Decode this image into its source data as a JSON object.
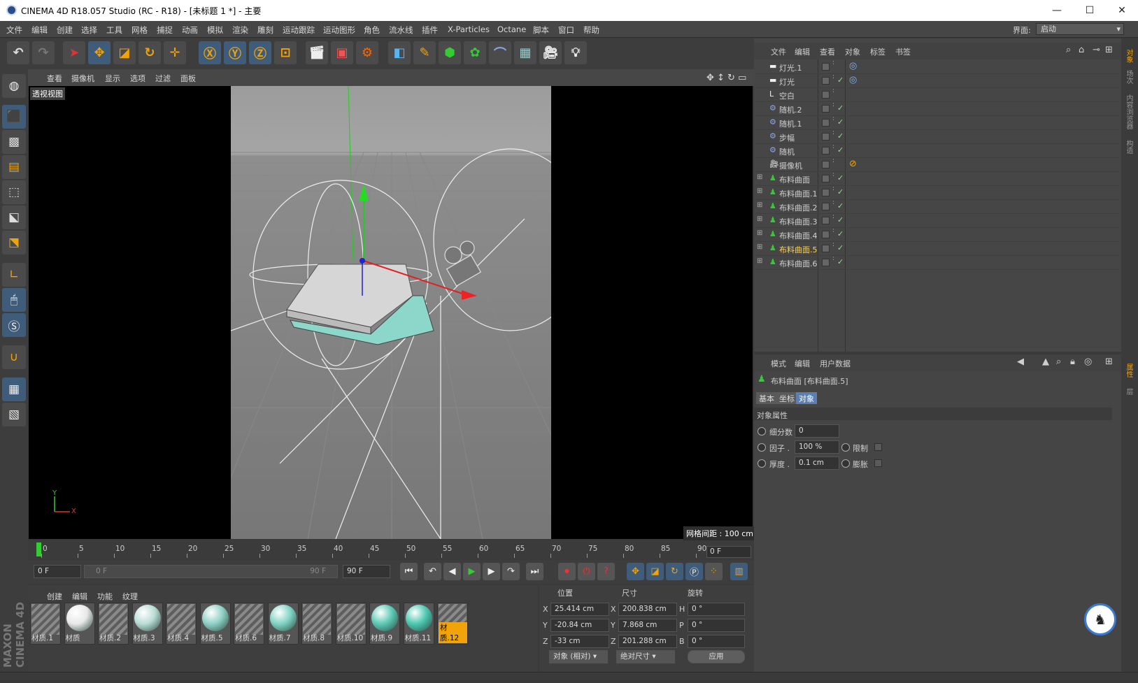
{
  "window": {
    "title": "CINEMA 4D R18.057 Studio (RC - R18) - [未标题 1 *] - 主要",
    "minimize": "—",
    "maximize": "☐",
    "close": "✕"
  },
  "menu": [
    "文件",
    "编辑",
    "创建",
    "选择",
    "工具",
    "网格",
    "捕捉",
    "动画",
    "模拟",
    "渲染",
    "雕刻",
    "运动跟踪",
    "运动图形",
    "角色",
    "流水线",
    "插件",
    "X-Particles",
    "Octane",
    "脚本",
    "窗口",
    "帮助"
  ],
  "layout": {
    "label": "界面:",
    "value": "启动"
  },
  "viewport": {
    "menu": [
      "查看",
      "摄像机",
      "显示",
      "选项",
      "过滤",
      "面板"
    ],
    "label": "透视视图",
    "grid_info": "网格间距 : 100 cm",
    "axis_y": "Y",
    "axis_x": "X"
  },
  "timeline": {
    "ticks": [
      "0",
      "5",
      "10",
      "15",
      "20",
      "25",
      "30",
      "35",
      "40",
      "45",
      "50",
      "55",
      "60",
      "65",
      "70",
      "75",
      "80",
      "85",
      "90"
    ],
    "current_frame": "0 F",
    "start_field": "0 F",
    "range_start": "0 F",
    "range_end": "90 F",
    "end_field": "90 F"
  },
  "materials": {
    "menu": [
      "创建",
      "编辑",
      "功能",
      "纹理"
    ],
    "items": [
      {
        "name": "材质.1",
        "kind": "striped"
      },
      {
        "name": "材质",
        "kind": "ball",
        "color": "#e8e8e8"
      },
      {
        "name": "材质.2",
        "kind": "striped"
      },
      {
        "name": "材质.3",
        "kind": "ball",
        "color": "#b8dcd4"
      },
      {
        "name": "材质.4",
        "kind": "striped"
      },
      {
        "name": "材质.5",
        "kind": "ball",
        "color": "#8fd0c4"
      },
      {
        "name": "材质.6",
        "kind": "striped"
      },
      {
        "name": "材质.7",
        "kind": "ball",
        "color": "#7fd4c4"
      },
      {
        "name": "材质.8",
        "kind": "striped"
      },
      {
        "name": "材质.10",
        "kind": "striped"
      },
      {
        "name": "材质.9",
        "kind": "ball",
        "color": "#5cc9b4"
      },
      {
        "name": "材质.11",
        "kind": "ball",
        "color": "#4cc8b0"
      },
      {
        "name": "材质.12",
        "kind": "striped",
        "selected": true
      }
    ]
  },
  "coords": {
    "headers": [
      "位置",
      "尺寸",
      "旋转"
    ],
    "rows": [
      {
        "a": "X",
        "pos": "25.414 cm",
        "b": "X",
        "size": "200.838 cm",
        "c": "H",
        "rot": "0 °"
      },
      {
        "a": "Y",
        "pos": "-20.84 cm",
        "b": "Y",
        "size": "7.868 cm",
        "c": "P",
        "rot": "0 °"
      },
      {
        "a": "Z",
        "pos": "-33 cm",
        "b": "Z",
        "size": "201.288 cm",
        "c": "B",
        "rot": "0 °"
      }
    ],
    "mode": "对象 (相对)",
    "size_mode": "绝对尺寸",
    "apply": "应用"
  },
  "objects": {
    "menu": [
      "文件",
      "编辑",
      "查看",
      "对象",
      "标签",
      "书签"
    ],
    "items": [
      {
        "name": "灯光.1",
        "icon": "light-icon",
        "check": false,
        "tag": "target-tag"
      },
      {
        "name": "灯光",
        "icon": "light-icon",
        "check": true,
        "tag": "target-tag"
      },
      {
        "name": "空白",
        "icon": "null-icon",
        "check": false,
        "tag": ""
      },
      {
        "name": "随机.2",
        "icon": "effector-icon",
        "check": true,
        "tag": ""
      },
      {
        "name": "随机.1",
        "icon": "effector-icon",
        "check": true,
        "tag": ""
      },
      {
        "name": "步幅",
        "icon": "effector-icon",
        "check": true,
        "tag": ""
      },
      {
        "name": "随机",
        "icon": "effector-icon",
        "check": true,
        "tag": ""
      },
      {
        "name": "摄像机",
        "icon": "camera-icon",
        "check": false,
        "tag": "protect-tag"
      },
      {
        "name": "布料曲面",
        "icon": "cloth-icon",
        "check": true,
        "tag": ""
      },
      {
        "name": "布料曲面.1",
        "icon": "cloth-icon",
        "check": true,
        "tag": ""
      },
      {
        "name": "布料曲面.2",
        "icon": "cloth-icon",
        "check": true,
        "tag": ""
      },
      {
        "name": "布料曲面.3",
        "icon": "cloth-icon",
        "check": true,
        "tag": ""
      },
      {
        "name": "布料曲面.4",
        "icon": "cloth-icon",
        "check": true,
        "tag": ""
      },
      {
        "name": "布料曲面.5",
        "icon": "cloth-icon",
        "check": true,
        "tag": "",
        "selected": true
      },
      {
        "name": "布料曲面.6",
        "icon": "cloth-icon",
        "check": true,
        "tag": ""
      }
    ]
  },
  "attributes": {
    "menu": [
      "模式",
      "编辑",
      "用户数据"
    ],
    "object_title": "布料曲面 [布料曲面.5]",
    "tabs": [
      "基本",
      "坐标",
      "对象"
    ],
    "active_tab": "对象",
    "section": "对象属性",
    "fields": {
      "subdiv_label": "细分数",
      "subdiv_value": "0",
      "factor_label": "因子 .",
      "factor_value": "100 %",
      "limit_label": "限制",
      "thickness_label": "厚度 .",
      "thickness_value": "0.1 cm",
      "inflate_label": "膨胀"
    }
  },
  "right_tabs": [
    "对象",
    "场次",
    "内容浏览器",
    "构造",
    "属性",
    "层"
  ],
  "maxon_logo": "MAXON CINEMA 4D",
  "colors": {
    "accent": "#f0a30a",
    "selected_obj": "#ffd34f",
    "check": "#8de08d",
    "active_tab": "#5a7fb0"
  }
}
